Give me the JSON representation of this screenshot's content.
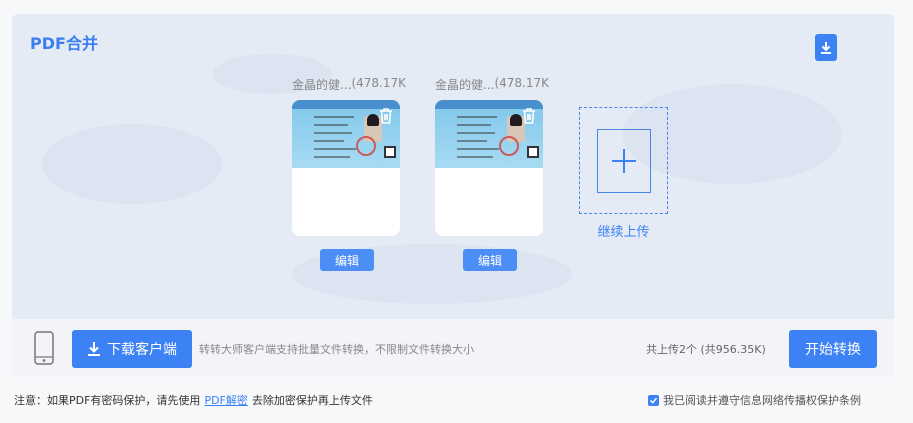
{
  "panel": {
    "title": "PDF合并"
  },
  "files": [
    {
      "name": "金晶的健...",
      "size": "(478.17K",
      "edit_label": "编辑"
    },
    {
      "name": "金晶的健...",
      "size": "(478.17K",
      "edit_label": "编辑"
    }
  ],
  "upload": {
    "label": "继续上传"
  },
  "bar": {
    "download_label": "下载客户端",
    "description": "转转大师客户端支持批量文件转换，不限制文件转换大小",
    "count": "共上传2个 (共956.35K)",
    "start_label": "开始转换"
  },
  "notice": {
    "prefix": "注意：如果PDF有密码保护，请先使用",
    "link": "PDF解密",
    "suffix": "去除加密保护再上传文件"
  },
  "agreement": {
    "label": "我已阅读并遵守信息网络传播权保护条例",
    "checked": true
  },
  "colors": {
    "accent": "#3d82f5",
    "panel_bg": "#e4ebf5"
  },
  "icons": [
    "download-icon",
    "trash-icon",
    "plus-icon",
    "phone-icon",
    "check-icon"
  ]
}
